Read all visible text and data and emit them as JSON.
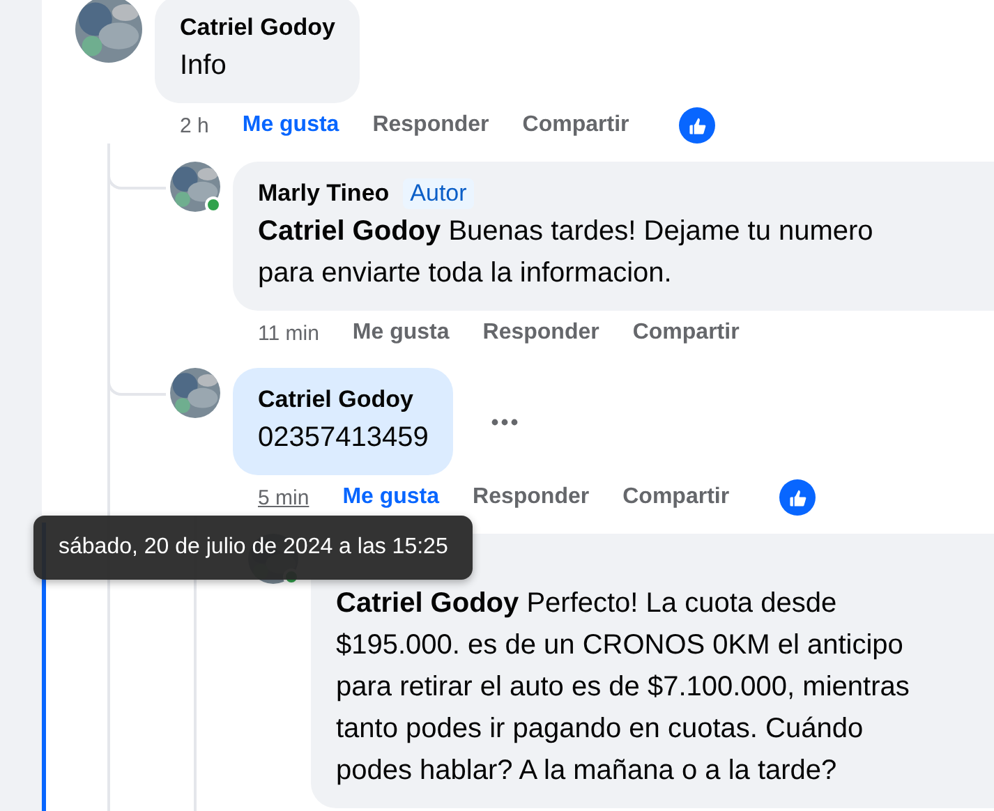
{
  "comments": [
    {
      "author": "Catriel Godoy",
      "text": "Info",
      "online": false,
      "highlighted": false,
      "menu": false,
      "time": "2 h",
      "time_hovered": false,
      "reaction": true,
      "actions": [
        {
          "label": "Me gusta",
          "selected": true
        },
        {
          "label": "Responder",
          "selected": false
        },
        {
          "label": "Compartir",
          "selected": false
        }
      ],
      "children": [
        {
          "author": "Marly Tineo",
          "badge": "Autor",
          "text": "**Catriel Godoy** Buenas tardes! Dejame tu numero para enviarte toda la informacion.",
          "online": true,
          "highlighted": false,
          "menu": false,
          "time": "11 min",
          "time_hovered": false,
          "reaction": false,
          "actions": [
            {
              "label": "Me gusta",
              "selected": false
            },
            {
              "label": "Responder",
              "selected": false
            },
            {
              "label": "Compartir",
              "selected": false
            }
          ]
        },
        {
          "author": "Catriel Godoy",
          "text": "02357413459",
          "online": false,
          "highlighted": true,
          "menu": true,
          "time": "5 min",
          "time_hovered": true,
          "reaction": true,
          "actions": [
            {
              "label": "Me gusta",
              "selected": true
            },
            {
              "label": "Responder",
              "selected": false
            },
            {
              "label": "Compartir",
              "selected": false
            }
          ],
          "children": [
            {
              "text": "**Catriel Godoy** Perfecto! La cuota desde $195.000. es de un CRONOS 0KM el anticipo para retirar el auto es de $7.100.000, mientras tanto podes ir pagando en cuotas. Cuándo podes hablar? A la mañana o a la tarde?",
              "online": true,
              "highlighted": false
            }
          ]
        }
      ]
    }
  ],
  "tooltip": "sábado, 20 de julio de 2024 a las 15:25"
}
